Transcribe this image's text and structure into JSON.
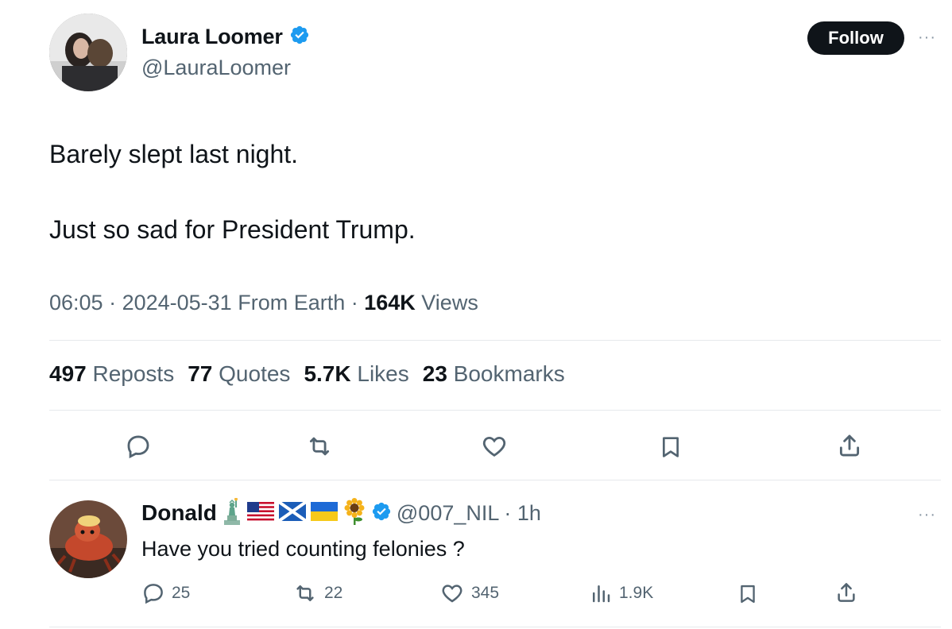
{
  "tweet": {
    "author": {
      "name": "Laura Loomer",
      "handle": "@LauraLoomer",
      "verified": true
    },
    "follow_label": "Follow",
    "more_label": "···",
    "text_lines": [
      "Barely slept last night.",
      "Just so sad for President Trump."
    ],
    "meta": {
      "time": "06:05",
      "sep1": " · ",
      "date": "2024-05-31",
      "source": " From Earth",
      "sep2": " · ",
      "views_count": "164K",
      "views_label": " Views"
    },
    "stats": [
      {
        "count": "497",
        "label": " Reposts"
      },
      {
        "count": "77",
        "label": " Quotes"
      },
      {
        "count": "5.7K",
        "label": " Likes"
      },
      {
        "count": "23",
        "label": " Bookmarks"
      }
    ]
  },
  "reply": {
    "author": {
      "name": "Donald",
      "handle": "@007_NIL",
      "time": " · 1h",
      "verified": true
    },
    "emojis": [
      "statue-of-liberty-icon",
      "us-flag-icon",
      "scotland-flag-icon",
      "ukraine-flag-icon",
      "sunflower-icon"
    ],
    "text": "Have you tried counting felonies ?",
    "more_label": "···",
    "actions": {
      "replies": "25",
      "reposts": "22",
      "likes": "345",
      "views": "1.9K"
    }
  },
  "colors": {
    "text": "#0f1419",
    "secondary": "#536471",
    "verified": "#1d9bf0",
    "follow_bg": "#0f1419"
  }
}
